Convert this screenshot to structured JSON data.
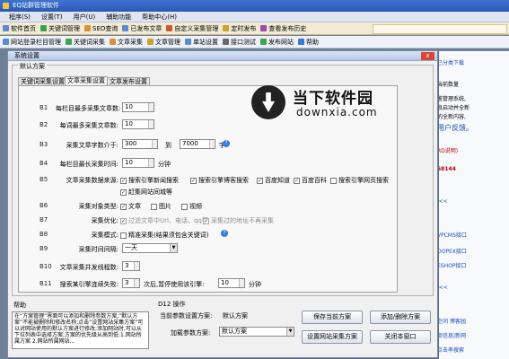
{
  "app": {
    "title": "EQ站群管理软件"
  },
  "menu": [
    "程序(S)",
    "设置(T)",
    "用户(U)",
    "辅助功能",
    "帮助中心(H)"
  ],
  "toolbar1": [
    "软件首页",
    "关键词管理",
    "SEO查询",
    "已发布文章",
    "自定义采集管理",
    "定时发布",
    "查看发布历史"
  ],
  "toolbar2": [
    "网站登录栏目管理",
    "关键词采集",
    "文章采集",
    "文章管理",
    "单站设置",
    "接口测试",
    "发布网站",
    "帮助"
  ],
  "right_panel": [
    "已分类下载",
    "当前数量",
    "鉴管理系统,",
    "息启动并全新",
    "的全新内容,",
    "用户反馈。",
    "RD说明)",
    "58144",
    "i<<",
    "VPCMS接口",
    "DOPEX接口",
    "ESHOP接口",
    "i<<",
    "空间 博客园",
    "商信息|新网",
    "点击率搜索"
  ],
  "dialog": {
    "title": "系统设置",
    "close": "x",
    "group_default": "默认方案",
    "tabs": [
      "关键词采集设置",
      "文章采集设置",
      "文章发布设置"
    ],
    "rows": [
      {
        "id": "B1",
        "label": "每栏目最多采集文章数:",
        "value": "10"
      },
      {
        "id": "B2",
        "label": "每词最多采集文章数:",
        "value": "10"
      },
      {
        "id": "B3",
        "label": "采集文章字数介于:",
        "from": "300",
        "to_label": "到",
        "to": "7000",
        "unit": "字"
      },
      {
        "id": "B4",
        "label": "每栏目最长采集时间:",
        "value": "10",
        "unit": "分钟"
      },
      {
        "id": "B5",
        "label": "文章采集数据来源:"
      },
      {
        "id": "B6",
        "label": "采集对象类型:"
      },
      {
        "id": "B7",
        "label": "采集优化:"
      },
      {
        "id": "B8",
        "label": "采集模式:"
      },
      {
        "id": "B9",
        "label": "采集时间间隔:",
        "value": "一天"
      },
      {
        "id": "B10",
        "label": "文章采集并发线程数:",
        "value": "3"
      },
      {
        "id": "B11",
        "label": "搜索某引擎连续失败:",
        "value": "3",
        "mid": "次后,暂停使用该引擎:",
        "value2": "10",
        "unit": "分钟"
      }
    ],
    "sources": [
      {
        "label": "搜索引擎新闻搜索",
        "checked": true
      },
      {
        "label": "搜索引擎博客搜索",
        "checked": true
      },
      {
        "label": "百度知道",
        "checked": true
      },
      {
        "label": "百度百科",
        "checked": true
      },
      {
        "label": "搜索引擎网页搜索",
        "checked": false
      },
      {
        "label": "赶集网站同城等",
        "checked": true
      }
    ],
    "types": [
      {
        "label": "文章",
        "checked": true
      },
      {
        "label": "图片",
        "checked": false
      },
      {
        "label": "视频",
        "checked": false
      }
    ],
    "optimize": [
      {
        "label": "过滤文章中Url、电话、qq等",
        "checked": true
      },
      {
        "label": "采集过的地址不再采集",
        "checked": true
      }
    ],
    "mode": [
      {
        "label": "精准采集(结果须包含关键词)",
        "checked": false
      }
    ],
    "help_title": "帮助",
    "help_text": "在“方案管理”界面可以添加和删除参数方案,“默认方案”不能被删除和修改名称;点击“设置网站采集方案”可以对网站使用的默认方案进行修改;添加网站时,可以从下拉列表中选择方案;方案的优先级从高到低:1.网站所属方案 2.网站所属网站...",
    "d12_label": "D12 操作",
    "current_label": "当前参数设置方案:",
    "current_value": "默认方案",
    "load_label": "加载参数方案:",
    "load_value": "默认方案",
    "buttons": [
      "保存当前方案",
      "添加/删除方案",
      "设置网站采集方案",
      "关闭本窗口"
    ]
  },
  "watermark": {
    "title": "当下软件园",
    "url": "downxia.com"
  }
}
